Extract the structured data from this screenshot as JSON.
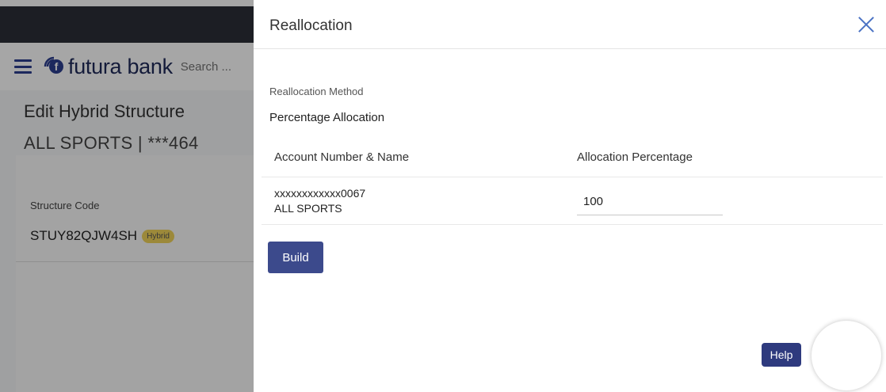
{
  "app": {
    "brand": "futura bank",
    "search_placeholder": "Search ..."
  },
  "background_page": {
    "title": "Edit Hybrid Structure",
    "subtitle": "ALL SPORTS | ***464",
    "structure_code_label": "Structure Code",
    "structure_code_value": "STUY82QJW4SH",
    "badge": "Hybrid"
  },
  "panel": {
    "title": "Reallocation",
    "method_label": "Reallocation Method",
    "method_value": "Percentage Allocation",
    "columns": {
      "account": "Account Number & Name",
      "percentage": "Allocation Percentage"
    },
    "rows": [
      {
        "account_number": "xxxxxxxxxxxx0067",
        "account_name": "ALL SPORTS",
        "percentage": "100"
      }
    ],
    "build_label": "Build",
    "help_label": "Help"
  },
  "colors": {
    "primary": "#3c4a8c",
    "close": "#4a72c4",
    "badge": "#f0d35a",
    "topbar": "#2b2e38"
  }
}
